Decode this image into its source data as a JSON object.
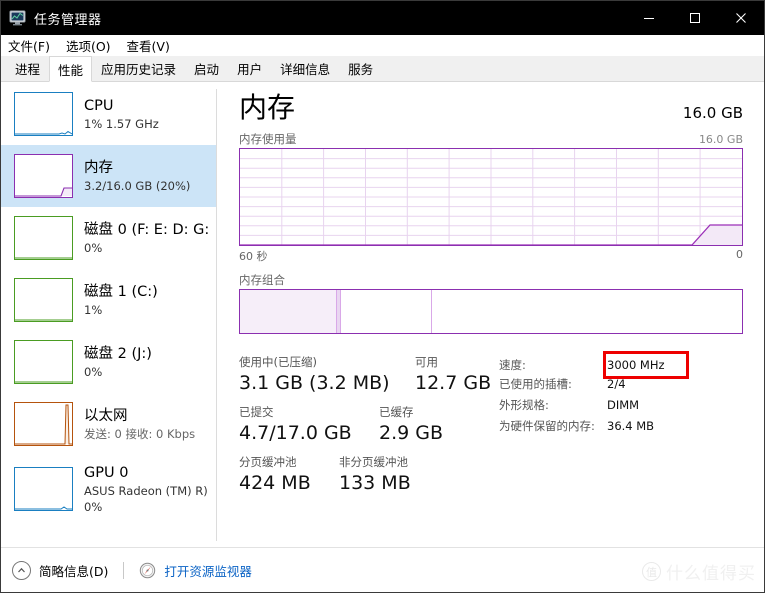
{
  "window": {
    "title": "任务管理器",
    "icon": "task-manager-icon",
    "minimize_label": "最小化",
    "maximize_label": "最大化",
    "close_label": "关闭"
  },
  "menubar": {
    "items": [
      {
        "label": "文件(F)"
      },
      {
        "label": "选项(O)"
      },
      {
        "label": "查看(V)"
      }
    ]
  },
  "tabs": [
    {
      "label": "进程",
      "active": false
    },
    {
      "label": "性能",
      "active": true
    },
    {
      "label": "应用历史记录",
      "active": false
    },
    {
      "label": "启动",
      "active": false
    },
    {
      "label": "用户",
      "active": false
    },
    {
      "label": "详细信息",
      "active": false
    },
    {
      "label": "服务",
      "active": false
    }
  ],
  "sidebar": {
    "items": [
      {
        "name": "cpu",
        "title": "CPU",
        "sub": "1% 1.57 GHz",
        "sub2": "",
        "color": "#1a7fc1",
        "selected": false,
        "spark": "flat-low"
      },
      {
        "name": "memory",
        "title": "内存",
        "sub": "3.2/16.0 GB (20%)",
        "sub2": "",
        "color": "#8b2fb0",
        "selected": true,
        "spark": "step-right"
      },
      {
        "name": "disk-0",
        "title": "磁盘 0 (F: E: D: G:",
        "sub": "0%",
        "sub2": "",
        "color": "#4a9c22",
        "selected": false,
        "spark": "flat-zero"
      },
      {
        "name": "disk-1",
        "title": "磁盘 1 (C:)",
        "sub": "1%",
        "sub2": "",
        "color": "#4a9c22",
        "selected": false,
        "spark": "flat-zero"
      },
      {
        "name": "disk-2",
        "title": "磁盘 2 (J:)",
        "sub": "0%",
        "sub2": "",
        "color": "#4a9c22",
        "selected": false,
        "spark": "flat-zero"
      },
      {
        "name": "ethernet",
        "title": "以太网",
        "sub": "发送: 0 接收: 0 Kbps",
        "sub2": "",
        "color": "#b5530d",
        "selected": false,
        "spark": "spike-right"
      },
      {
        "name": "gpu-0",
        "title": "GPU 0",
        "sub": "ASUS Radeon (TM) R)",
        "sub2": "0%",
        "color": "#1a7fc1",
        "selected": false,
        "spark": "flat-low"
      }
    ]
  },
  "main": {
    "title": "内存",
    "total": "16.0 GB",
    "graph_caption": "内存使用量",
    "graph_max": "16.0 GB",
    "axis_left": "60 秒",
    "axis_right": "0",
    "composition_caption": "内存组合",
    "accent_color": "#8b2fb0",
    "stats": [
      {
        "name": "in-use",
        "label": "使用中(已压缩)",
        "value": "3.1 GB (3.2 MB)"
      },
      {
        "name": "available",
        "label": "可用",
        "value": "12.7 GB"
      },
      {
        "name": "committed",
        "label": "已提交",
        "value": "4.7/17.0 GB"
      },
      {
        "name": "cached",
        "label": "已缓存",
        "value": "2.9 GB"
      },
      {
        "name": "paged-pool",
        "label": "分页缓冲池",
        "value": "424 MB"
      },
      {
        "name": "nonpaged-pool",
        "label": "非分页缓冲池",
        "value": "133 MB"
      }
    ],
    "details": [
      {
        "name": "speed",
        "label": "速度:",
        "value": "3000 MHz",
        "highlighted": true
      },
      {
        "name": "slots-used",
        "label": "已使用的插槽:",
        "value": "2/4",
        "highlighted": false
      },
      {
        "name": "form-factor",
        "label": "外形规格:",
        "value": "DIMM",
        "highlighted": false
      },
      {
        "name": "hardware-reserved",
        "label": "为硬件保留的内存:",
        "value": "36.4 MB",
        "highlighted": false
      }
    ],
    "highlight_color": "#ee0000"
  },
  "footer": {
    "fewer_details": "简略信息(D)",
    "open_resource_monitor": "打开资源监视器",
    "link_color": "#0b63c5"
  },
  "watermark": {
    "mark": "值",
    "text": "什么值得买"
  },
  "chart_data": {
    "type": "area",
    "title": "内存使用量",
    "ylabel": "",
    "xlabel": "",
    "ylim": [
      0,
      16.0
    ],
    "y_unit": "GB",
    "xlim": [
      60,
      0
    ],
    "x_unit": "秒",
    "grid": true,
    "series": [
      {
        "name": "内存使用量",
        "color": "#8b2fb0",
        "x": [
          60,
          10,
          7,
          4,
          2,
          0
        ],
        "values": [
          0,
          0,
          0,
          2.4,
          3.2,
          3.2
        ]
      }
    ]
  }
}
